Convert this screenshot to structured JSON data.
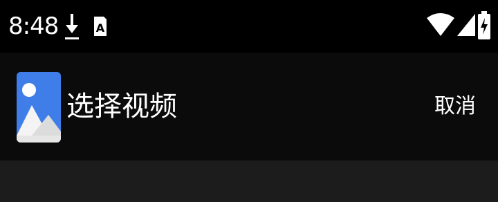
{
  "status_bar": {
    "time": "8:48",
    "icons": [
      "download-icon",
      "sim-icon",
      "wifi-icon",
      "signal-icon",
      "battery-icon"
    ],
    "sim_icon_letter": "A"
  },
  "app_bar": {
    "title": "选择视频",
    "cancel_label": "取消",
    "icon": "photos-icon",
    "icon_color": "#3f7ee8"
  },
  "colors": {
    "status_bar_bg": "#000000",
    "app_bar_bg": "#0b0b0b",
    "content_bg": "#1c1c1c",
    "text": "#ffffff"
  }
}
